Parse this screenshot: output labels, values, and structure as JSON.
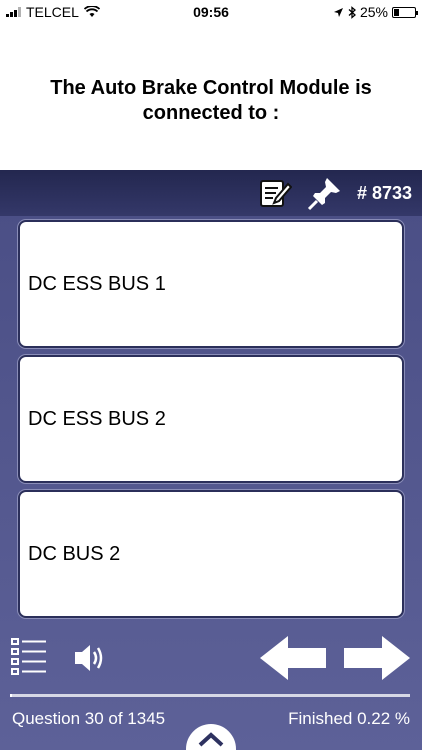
{
  "status_bar": {
    "carrier": "TELCEL",
    "time": "09:56",
    "battery": "25%",
    "battery_level": 0.25
  },
  "question": {
    "text": "The Auto Brake Control Module is connected to :"
  },
  "toolbar": {
    "notes_icon": "edit-note-icon",
    "pin_icon": "pushpin-icon",
    "reference": "# 8733"
  },
  "answers": [
    {
      "label": "DC ESS BUS 1"
    },
    {
      "label": "DC ESS BUS 2"
    },
    {
      "label": "DC BUS 2"
    }
  ],
  "controls": {
    "list_icon": "question-list-icon",
    "audio_icon": "speaker-icon",
    "prev_icon": "arrow-left-icon",
    "next_icon": "arrow-right-icon"
  },
  "progress": {
    "question_counter": "Question 30 of 1345",
    "finished": "Finished 0.22 %",
    "fraction": 0.0022
  },
  "colors": {
    "primary_blue": "#4b4f86",
    "toolbar_dark": "#23274f"
  }
}
